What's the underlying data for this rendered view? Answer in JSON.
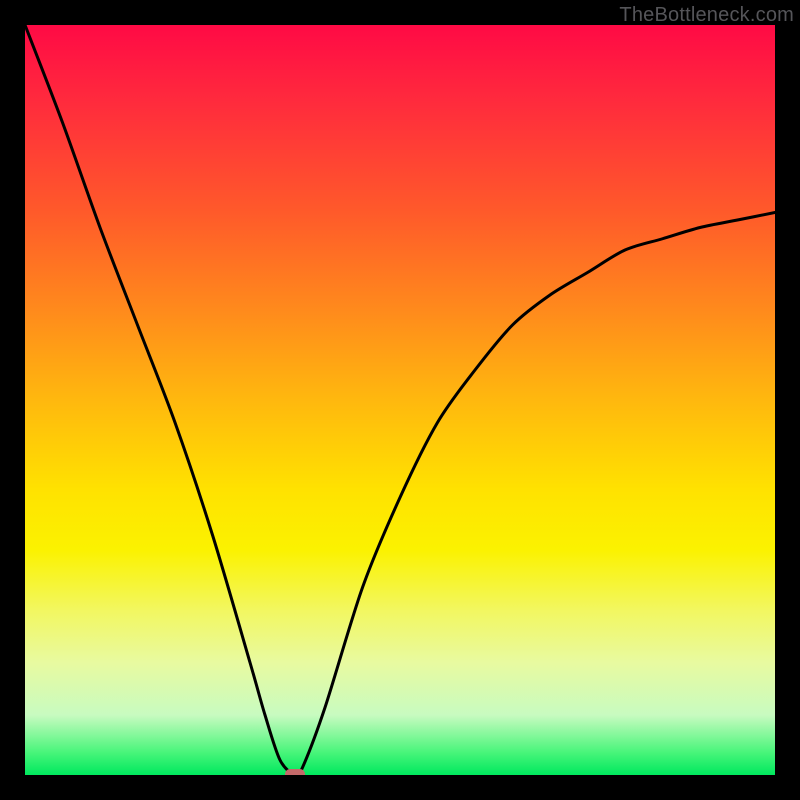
{
  "watermark": {
    "text": "TheBottleneck.com"
  },
  "chart_data": {
    "type": "line",
    "title": "",
    "xlabel": "",
    "ylabel": "",
    "x_range": [
      0,
      100
    ],
    "y_range": [
      0,
      100
    ],
    "grid": false,
    "legend": false,
    "series": [
      {
        "name": "bottleneck-curve",
        "x": [
          0,
          5,
          10,
          15,
          20,
          25,
          30,
          32,
          34,
          36,
          37,
          40,
          45,
          50,
          55,
          60,
          65,
          70,
          75,
          80,
          85,
          90,
          95,
          100
        ],
        "y": [
          100,
          87,
          73,
          60,
          47,
          32,
          15,
          8,
          2,
          0,
          1,
          9,
          25,
          37,
          47,
          54,
          60,
          64,
          67,
          70,
          71.5,
          73,
          74,
          75
        ]
      }
    ],
    "marker": {
      "x": 36,
      "y": 0,
      "color": "#c46a6a",
      "shape": "rounded-pill"
    },
    "background_gradient": {
      "top": "#ff0a45",
      "middle": "#ffe200",
      "bottom": "#00e85e"
    }
  }
}
